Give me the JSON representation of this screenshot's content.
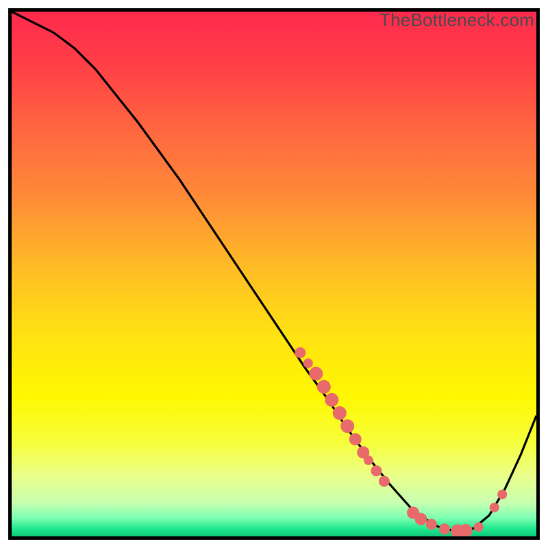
{
  "watermark": "TheBottleneck.com",
  "chart_data": {
    "type": "line",
    "title": "",
    "xlabel": "",
    "ylabel": "",
    "xlim": [
      0,
      100
    ],
    "ylim": [
      0,
      100
    ],
    "series": [
      {
        "name": "curve",
        "x": [
          0,
          4,
          8,
          12,
          16,
          20,
          24,
          28,
          32,
          36,
          40,
          44,
          48,
          52,
          56,
          60,
          64,
          68,
          72,
          76,
          80,
          82,
          85,
          88,
          91,
          94,
          97,
          100
        ],
        "y": [
          100,
          98,
          96,
          93,
          89,
          84,
          79,
          73.5,
          68,
          62,
          56,
          50,
          44,
          38,
          32,
          26.5,
          20.5,
          15,
          10,
          5.5,
          2.5,
          1.5,
          1.0,
          1.5,
          4,
          9,
          15.5,
          23
        ]
      }
    ],
    "scatter_points": {
      "name": "markers",
      "color": "#e86a6a",
      "points": [
        {
          "x": 55,
          "y": 35,
          "r": 8
        },
        {
          "x": 56.5,
          "y": 33,
          "r": 7
        },
        {
          "x": 58,
          "y": 31,
          "r": 10
        },
        {
          "x": 59.5,
          "y": 28.5,
          "r": 10
        },
        {
          "x": 61,
          "y": 26,
          "r": 10
        },
        {
          "x": 62.5,
          "y": 23.5,
          "r": 10
        },
        {
          "x": 64,
          "y": 21,
          "r": 10
        },
        {
          "x": 65.5,
          "y": 18.5,
          "r": 9
        },
        {
          "x": 67,
          "y": 16,
          "r": 9
        },
        {
          "x": 68,
          "y": 14.5,
          "r": 7
        },
        {
          "x": 69.5,
          "y": 12.5,
          "r": 8
        },
        {
          "x": 71,
          "y": 10.5,
          "r": 8
        },
        {
          "x": 76.5,
          "y": 4.5,
          "r": 9
        },
        {
          "x": 78,
          "y": 3.3,
          "r": 9
        },
        {
          "x": 80,
          "y": 2.3,
          "r": 8
        },
        {
          "x": 82.5,
          "y": 1.4,
          "r": 8
        },
        {
          "x": 85,
          "y": 1.0,
          "r": 10
        },
        {
          "x": 86.5,
          "y": 1.05,
          "r": 10
        },
        {
          "x": 89,
          "y": 1.8,
          "r": 7
        },
        {
          "x": 92,
          "y": 5.5,
          "r": 7
        },
        {
          "x": 93.5,
          "y": 8.0,
          "r": 7
        }
      ]
    },
    "gradient_stops": [
      {
        "offset": 0.0,
        "color": "#ff2a4d"
      },
      {
        "offset": 0.1,
        "color": "#ff3f47"
      },
      {
        "offset": 0.22,
        "color": "#ff6540"
      },
      {
        "offset": 0.35,
        "color": "#ff8a38"
      },
      {
        "offset": 0.5,
        "color": "#ffc024"
      },
      {
        "offset": 0.62,
        "color": "#ffe312"
      },
      {
        "offset": 0.73,
        "color": "#fff700"
      },
      {
        "offset": 0.82,
        "color": "#f7ff3a"
      },
      {
        "offset": 0.885,
        "color": "#eaff8a"
      },
      {
        "offset": 0.935,
        "color": "#c8ffb0"
      },
      {
        "offset": 0.965,
        "color": "#7dffb2"
      },
      {
        "offset": 0.985,
        "color": "#22e88f"
      },
      {
        "offset": 1.0,
        "color": "#0dc978"
      }
    ]
  }
}
